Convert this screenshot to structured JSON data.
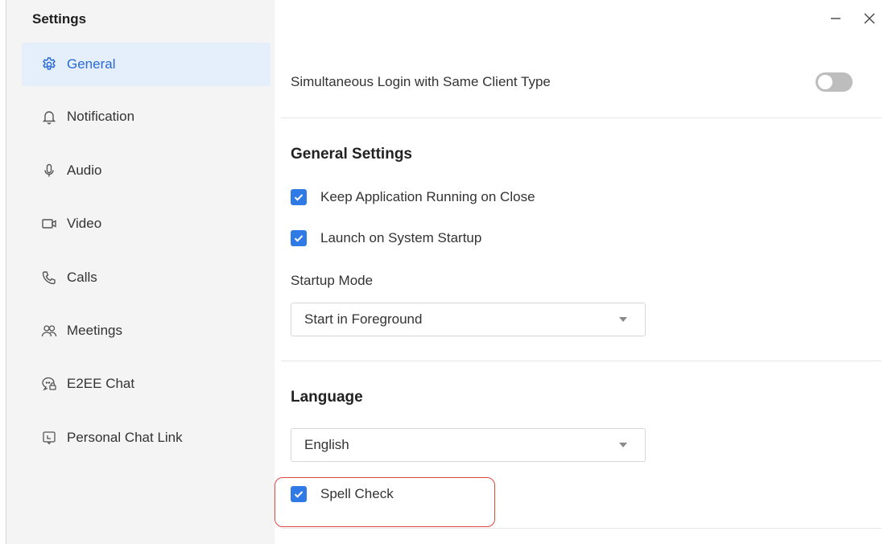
{
  "window": {
    "title": "Settings"
  },
  "sidebar": {
    "items": [
      {
        "label": "General",
        "icon": "gear-icon",
        "active": true
      },
      {
        "label": "Notification",
        "icon": "bell-icon",
        "active": false
      },
      {
        "label": "Audio",
        "icon": "microphone-icon",
        "active": false
      },
      {
        "label": "Video",
        "icon": "video-camera-icon",
        "active": false
      },
      {
        "label": "Calls",
        "icon": "phone-icon",
        "active": false
      },
      {
        "label": "Meetings",
        "icon": "people-icon",
        "active": false
      },
      {
        "label": "E2EE Chat",
        "icon": "encrypted-chat-icon",
        "active": false
      },
      {
        "label": "Personal Chat Link",
        "icon": "chat-link-icon",
        "active": false
      }
    ]
  },
  "main": {
    "simultaneous_login": {
      "label": "Simultaneous Login with Same Client Type",
      "enabled": false
    },
    "general_settings": {
      "title": "General Settings",
      "keep_running": {
        "label": "Keep Application Running on Close",
        "checked": true
      },
      "launch_on_startup": {
        "label": "Launch on System Startup",
        "checked": true
      },
      "startup_mode": {
        "label": "Startup Mode",
        "value": "Start in Foreground"
      }
    },
    "language": {
      "title": "Language",
      "value": "English",
      "spell_check": {
        "label": "Spell Check",
        "checked": true
      }
    }
  },
  "colors": {
    "accent": "#2f7ae5",
    "active_item_bg": "#e5eefb",
    "sidebar_bg": "#f4f4f4",
    "annotation_outline": "#e0483c"
  }
}
